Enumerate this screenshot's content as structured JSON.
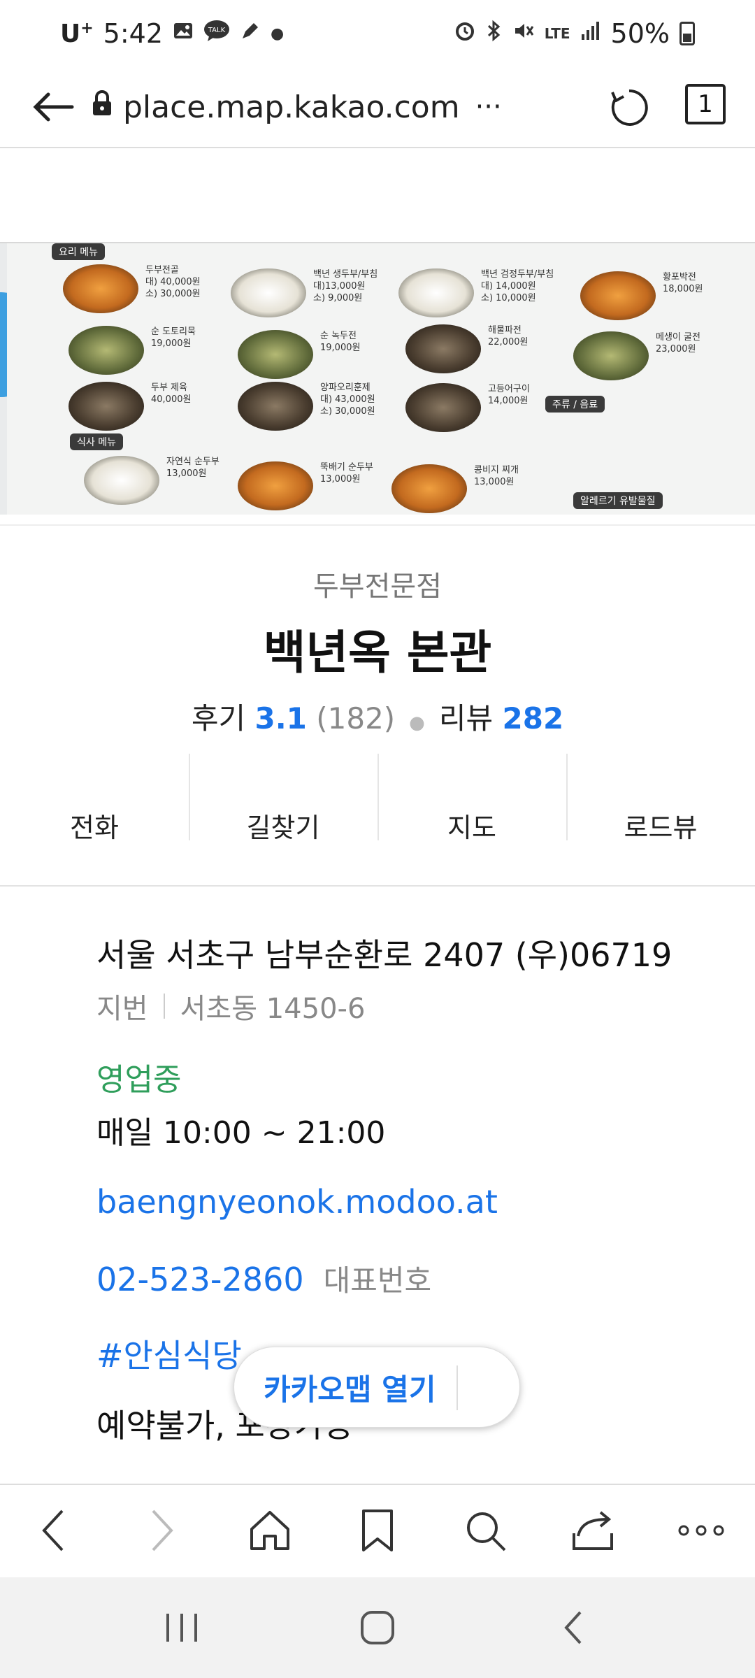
{
  "status_bar": {
    "carrier": "U",
    "carrier_sup": "+",
    "time": "5:42",
    "talk_badge": "TALK",
    "network": "LTE",
    "battery": "50%"
  },
  "url_bar": {
    "url": "place.map.kakao.com",
    "ellipsis": "···",
    "tab_count": "1"
  },
  "hero": {
    "menu_items": [
      {
        "name": "두부전골",
        "price": "대) 40,000원\n소) 30,000원",
        "dish": "red"
      },
      {
        "name": "백년 생두부/부침",
        "price": "대)13,000원\n소) 9,000원",
        "dish": "white"
      },
      {
        "name": "백년 검정두부/부침",
        "price": "대) 14,000원\n소) 10,000원",
        "dish": "white"
      },
      {
        "name": "황포박전",
        "price": "18,000원",
        "dish": "red"
      },
      {
        "name": "순 도토리묵",
        "price": "19,000원",
        "dish": "green"
      },
      {
        "name": "순 녹두전",
        "price": "19,000원",
        "dish": "green"
      },
      {
        "name": "해물파전",
        "price": "22,000원",
        "dish": "dark"
      },
      {
        "name": "메생이 굴전",
        "price": "23,000원",
        "dish": "green"
      },
      {
        "name": "두부 제육",
        "price": "40,000원",
        "dish": "dark"
      },
      {
        "name": "양파오리훈제",
        "price": "대) 43,000원\n소) 30,000원",
        "dish": "dark"
      },
      {
        "name": "고등어구이",
        "price": "14,000원",
        "dish": "dark"
      },
      {
        "name": "자연식 순두부",
        "price": "13,000원",
        "dish": "white"
      },
      {
        "name": "뚝배기 순두부",
        "price": "13,000원",
        "dish": "red"
      },
      {
        "name": "콩비지 찌개",
        "price": "13,000원",
        "dish": "red"
      }
    ],
    "banner_top": "요리 메뉴",
    "banner_meal": "식사 메뉴",
    "banner_drinks": "주류 / 음료",
    "banner_bottom": "알레르기 유발물질"
  },
  "place": {
    "category": "두부전문점",
    "name": "백년옥 본관",
    "review_label": "후기",
    "review_score": "3.1",
    "review_count": "(182)",
    "blog_label": "리뷰",
    "blog_count": "282"
  },
  "actions": [
    {
      "label": "전화"
    },
    {
      "label": "길찾기"
    },
    {
      "label": "지도"
    },
    {
      "label": "로드뷰"
    }
  ],
  "info": {
    "address": "서울 서초구 남부순환로 2407 (우)06719",
    "jibun_label": "지번",
    "jibun": "서초동 1450-6",
    "open_status": "영업중",
    "hours": "매일 10:00 ~ 21:00",
    "homepage": "baengnyeonok.modoo.at",
    "phone": "02-523-2860",
    "phone_label": "대표번호",
    "tag": "#안심식당",
    "extra": "예약불가, 포장가능"
  },
  "floating": {
    "open_app": "카카오맵 열기"
  },
  "icons": {
    "back": "back-arrow-icon",
    "lock": "lock-icon",
    "reload": "reload-icon",
    "home": "home-icon",
    "bookmark": "bookmark-icon",
    "search": "search-icon",
    "share": "share-icon",
    "more": "more-icon"
  }
}
